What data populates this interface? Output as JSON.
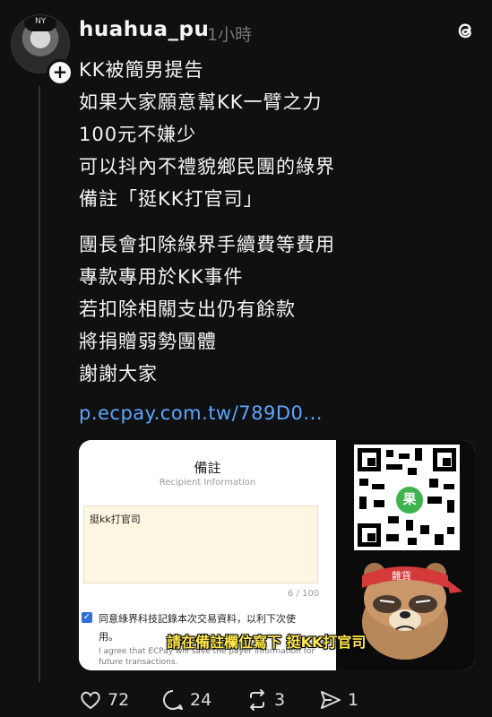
{
  "post": {
    "username": "huahua_pu",
    "time": "1小時",
    "lines": [
      "KK被簡男提告",
      "如果大家願意幫KK一臂之力",
      "100元不嫌少",
      "可以抖內不禮貌鄉民團的綠界",
      "備註「挺KK打官司」",
      "團長會扣除綠界手續費等費用",
      "專款專用於KK事件",
      "若扣除相關支出仍有餘款",
      "將捐贈弱勢團體",
      "謝謝大家"
    ],
    "link": "p.ecpay.com.tw/789D0..."
  },
  "card": {
    "title": "備註",
    "subtitle": "Recipient Information",
    "textarea_value": "挺kk打官司",
    "char_count": "6 / 100",
    "agree_line1": "同意綠界科技記錄本次交易資料，以利下次使",
    "agree_line2": "用。",
    "agree_en1": "I agree that ECPay will save the payer information for",
    "agree_en2": "future transactions.",
    "qr_badge": "果",
    "mascot_headband": "雜貨",
    "caption": "請在備註欄位寫下 挺KK打官司"
  },
  "actions": {
    "likes": "72",
    "comments": "24",
    "reposts": "3",
    "shares": "1"
  },
  "colors": {
    "background": "#101010",
    "link": "#5aa6ff",
    "caption": "#ffe84a"
  },
  "avatar_cap_text": "NY"
}
